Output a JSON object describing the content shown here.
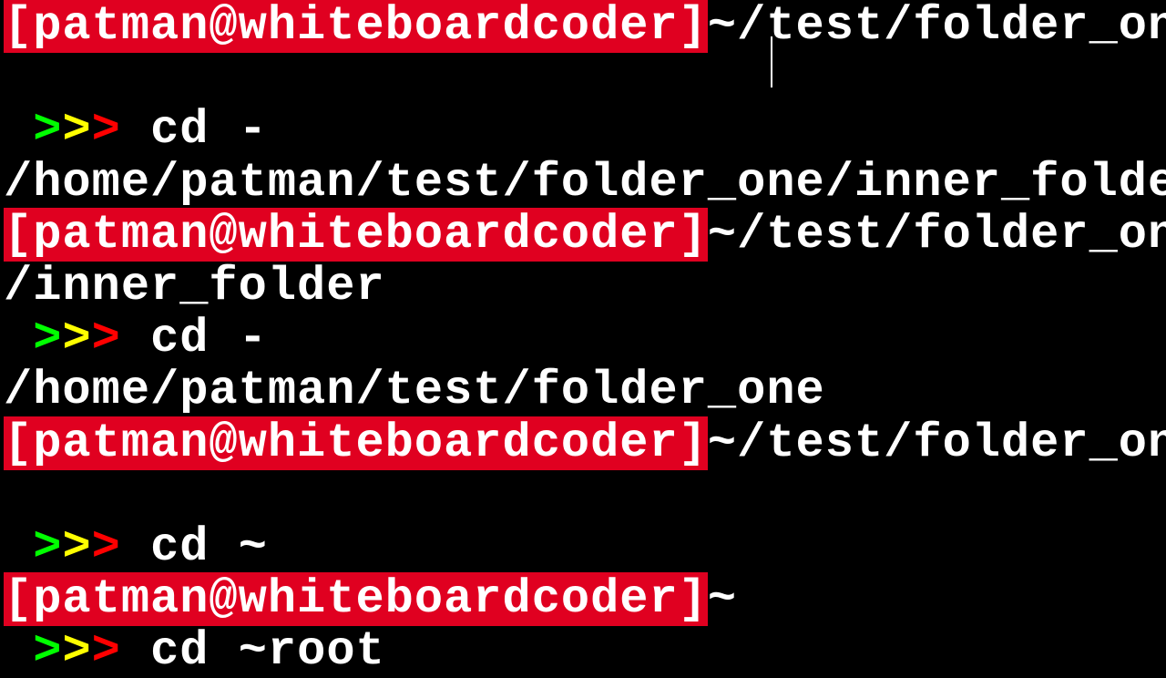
{
  "userhost": "[patman@whiteboardcoder]",
  "paths": {
    "folder_one": "~/test/folder_one",
    "folder_one_wrap": "",
    "inner": "~/test/folder_one",
    "inner_wrap": "/inner_folder",
    "home": "~"
  },
  "chev": {
    "g": ">",
    "y": ">",
    "r": ">"
  },
  "cmds": {
    "cd_dash": "cd -",
    "cd_home": "cd ~",
    "cd_root": "cd ~root"
  },
  "outputs": {
    "inner_full": "/home/patman/test/folder_one/inner_folder",
    "folder_one_full": "/home/patman/test/folder_one"
  }
}
